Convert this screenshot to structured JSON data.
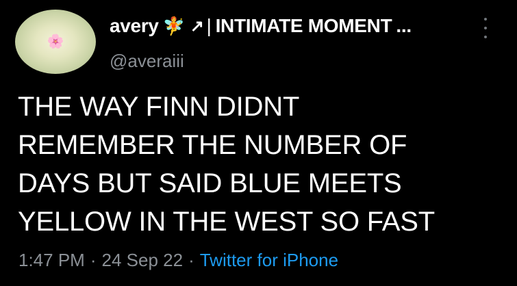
{
  "tweet": {
    "author": {
      "display_name": "avery",
      "name_emoji": "🧚",
      "name_arrow": "↗",
      "name_separator": "|",
      "name_title": "INTIMATE MOMENT",
      "name_ellipsis": "...",
      "handle": "@averaiii",
      "avatar_icon": "flower-icon",
      "avatar_glyph": "🌸"
    },
    "body_lines": [
      "THE WAY FINN DIDNT",
      "REMEMBER THE NUMBER OF",
      "DAYS BUT SAID BLUE MEETS",
      "YELLOW IN THE WEST SO FAST"
    ],
    "time": "1:47 PM",
    "date": "24 Sep 22",
    "meta_dot": "·",
    "source": "Twitter for iPhone",
    "more_icon": "more-vertical-icon"
  },
  "colors": {
    "background": "#000000",
    "text": "#ffffff",
    "secondary": "#8b9096",
    "link": "#1d9bf0"
  }
}
